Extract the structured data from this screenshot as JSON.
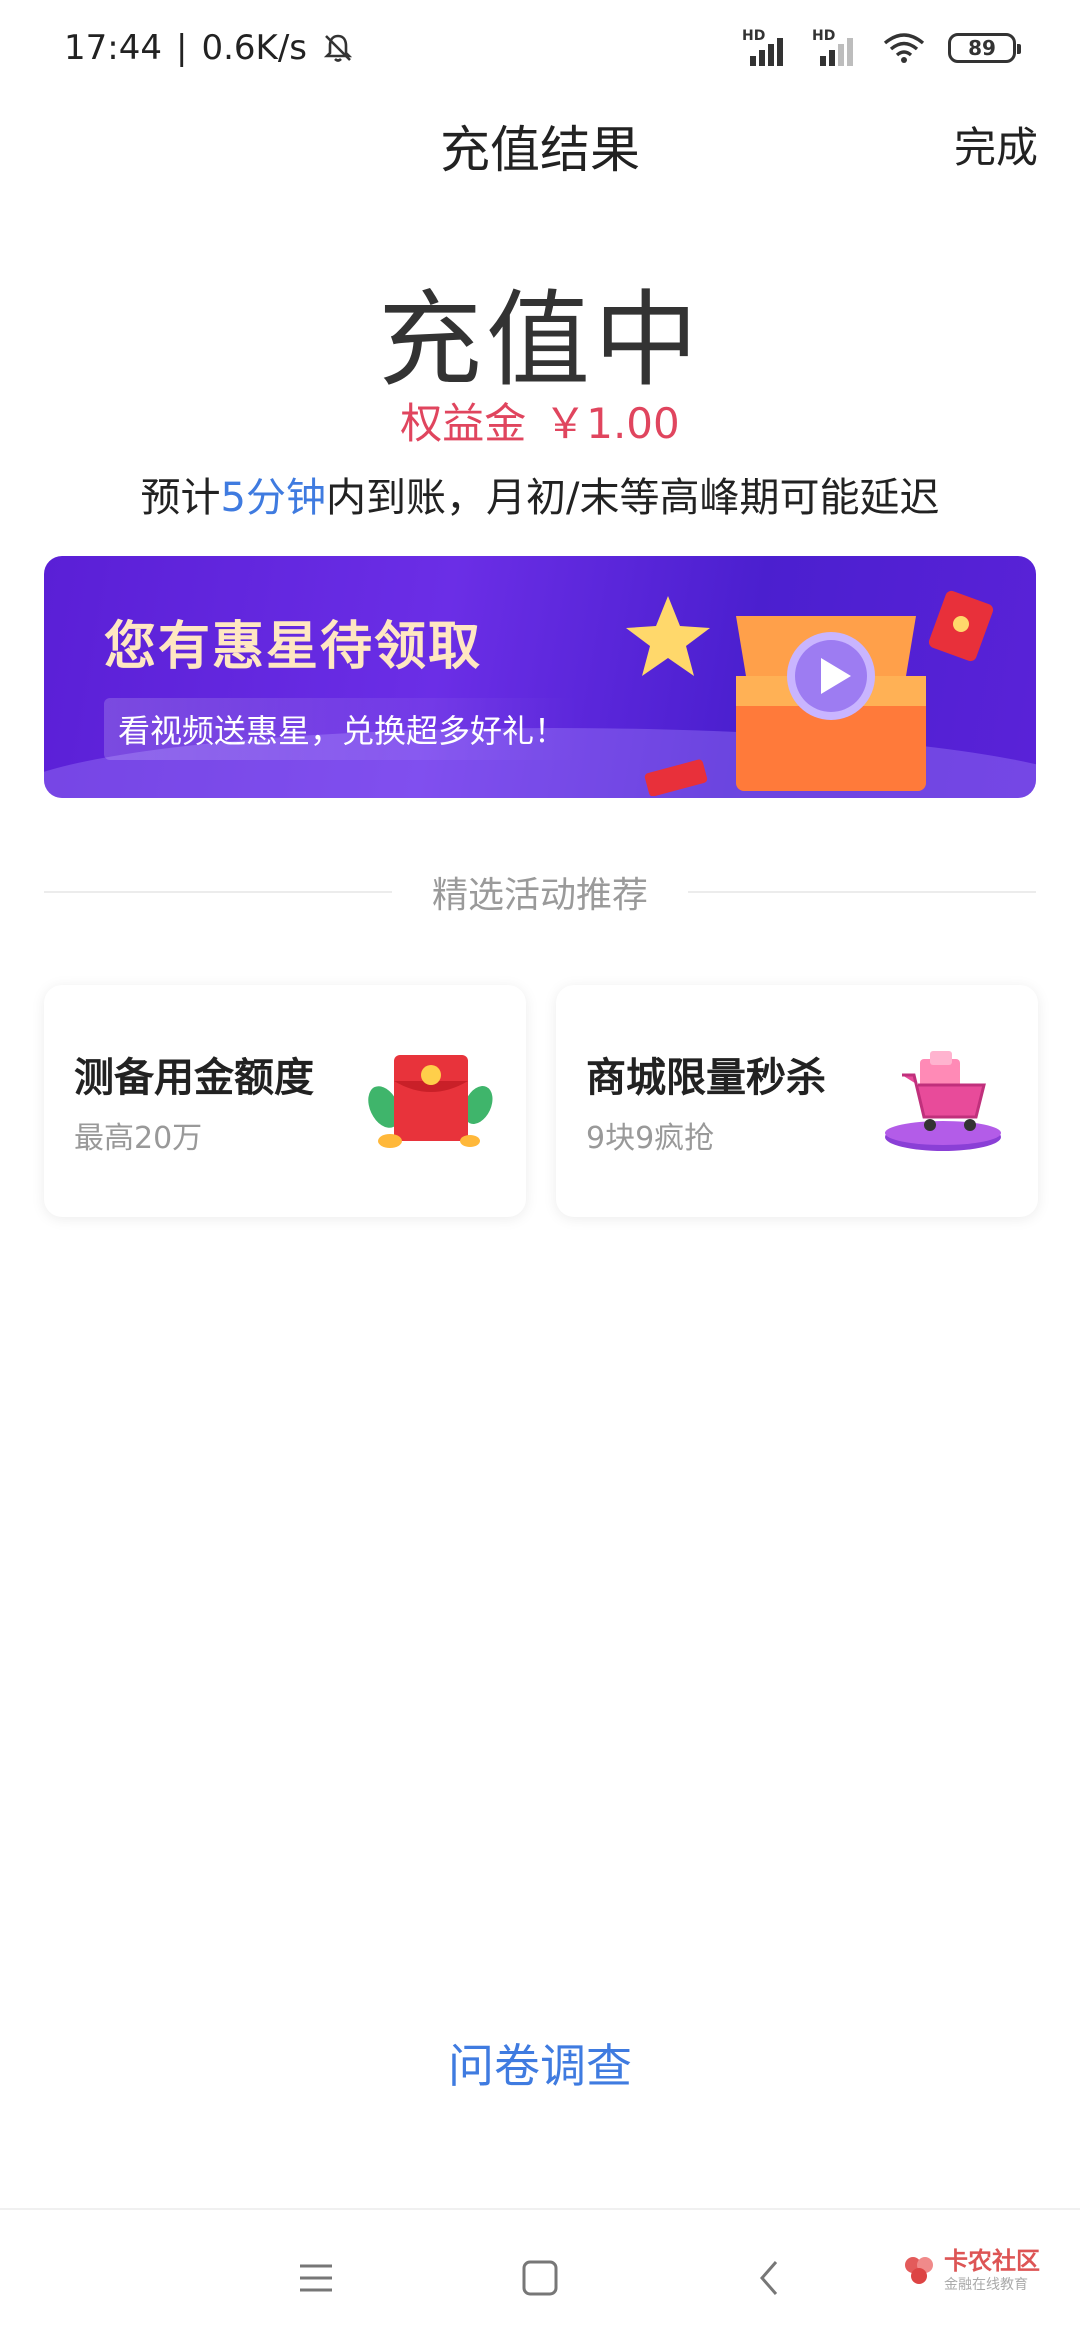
{
  "status_bar": {
    "time": "17:44",
    "separator": "|",
    "net_speed": "0.6K/s",
    "signal1_label": "HD",
    "signal2_label": "HD",
    "battery": "89"
  },
  "header": {
    "title": "充值结果",
    "done_label": "完成"
  },
  "result": {
    "status": "充值中",
    "amount_label": "权益金",
    "amount_value": "￥1.00",
    "eta_prefix": "预计",
    "eta_highlight": "5分钟",
    "eta_suffix": "内到账，月初/末等高峰期可能延迟"
  },
  "banner": {
    "title": "您有惠星待领取",
    "subtitle": "看视频送惠星，兑换超多好礼！"
  },
  "section": {
    "title": "精选活动推荐"
  },
  "cards": [
    {
      "title": "测备用金额度",
      "subtitle": "最高20万",
      "icon": "red-envelope-icon"
    },
    {
      "title": "商城限量秒杀",
      "subtitle": "9块9疯抢",
      "icon": "shopping-cart-icon"
    }
  ],
  "survey": {
    "label": "问卷调查"
  },
  "watermark": {
    "name": "卡农社区",
    "tagline": "金融在线教育"
  },
  "colors": {
    "accent_blue": "#3f7be0",
    "amount_red": "#e0455e",
    "banner_purple": "#5a1fd6"
  }
}
